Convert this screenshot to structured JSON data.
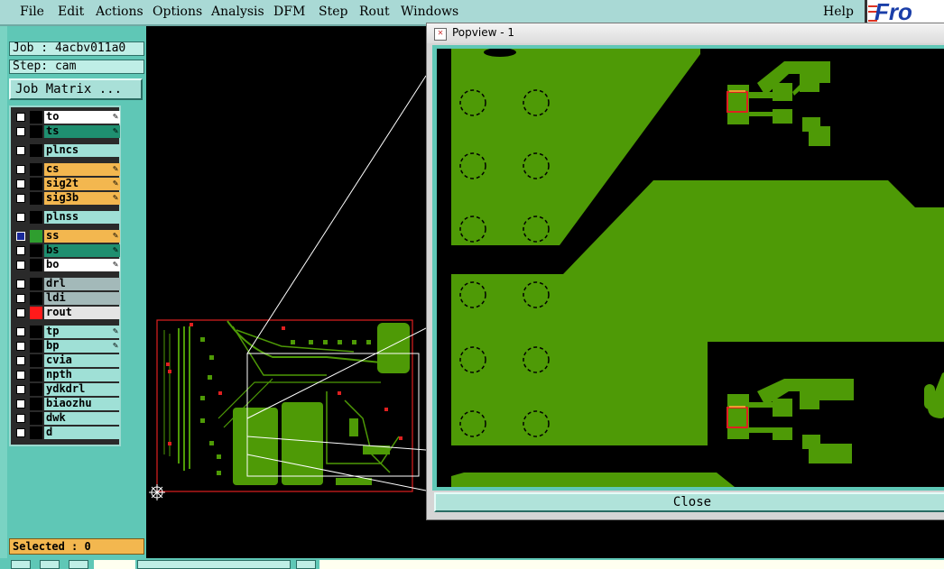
{
  "menubar": {
    "items": [
      "File",
      "Edit",
      "Actions",
      "Options",
      "Analysis",
      "DFM",
      "Step",
      "Rout",
      "Windows"
    ],
    "help": "Help",
    "brand": "Fro"
  },
  "job": {
    "job_label": "Job : 4acbv011a0",
    "step_label": "Step: cam",
    "matrix_button": "Job Matrix ..."
  },
  "layers": [
    {
      "name": "to",
      "bg": "#ffffff",
      "edit": true
    },
    {
      "name": "ts",
      "bg": "#1f8f70",
      "edit": true
    },
    {
      "name": "plncs",
      "bg": "#9fe0d6",
      "edit": false
    },
    {
      "name": "cs",
      "bg": "#f3b74f",
      "edit": true
    },
    {
      "name": "sig2t",
      "bg": "#f3b74f",
      "edit": true
    },
    {
      "name": "sig3b",
      "bg": "#f3b74f",
      "edit": true
    },
    {
      "name": "plnss",
      "bg": "#9fe0d6",
      "edit": false
    },
    {
      "name": "ss",
      "bg": "#f3b74f",
      "edit": true,
      "active": true
    },
    {
      "name": "bs",
      "bg": "#1f8f70",
      "edit": true
    },
    {
      "name": "bo",
      "bg": "#ffffff",
      "edit": true
    },
    {
      "name": "drl",
      "bg": "#a3b9b9",
      "edit": false
    },
    {
      "name": "ldi",
      "bg": "#a3b9b9",
      "edit": false
    },
    {
      "name": "rout",
      "bg": "#e4e4e4",
      "edit": false,
      "color": "#ff1a1a"
    },
    {
      "name": "tp",
      "bg": "#9fe0d6",
      "edit": true
    },
    {
      "name": "bp",
      "bg": "#9fe0d6",
      "edit": true
    },
    {
      "name": "cvia",
      "bg": "#9fe0d6",
      "edit": false
    },
    {
      "name": "npth",
      "bg": "#9fe0d6",
      "edit": false
    },
    {
      "name": "ydkdrl",
      "bg": "#9fe0d6",
      "edit": false
    },
    {
      "name": "biaozhu",
      "bg": "#9fe0d6",
      "edit": false
    },
    {
      "name": "dwk",
      "bg": "#9fe0d6",
      "edit": false
    },
    {
      "name": "d",
      "bg": "#9fe0d6",
      "edit": false
    }
  ],
  "status": {
    "selected": "Selected : 0"
  },
  "popup": {
    "title": "Popview - 1",
    "close_label": "Close"
  },
  "colors": {
    "copper": "#4e9a06",
    "outline": "#e02020",
    "highlight": "#e8a030"
  }
}
